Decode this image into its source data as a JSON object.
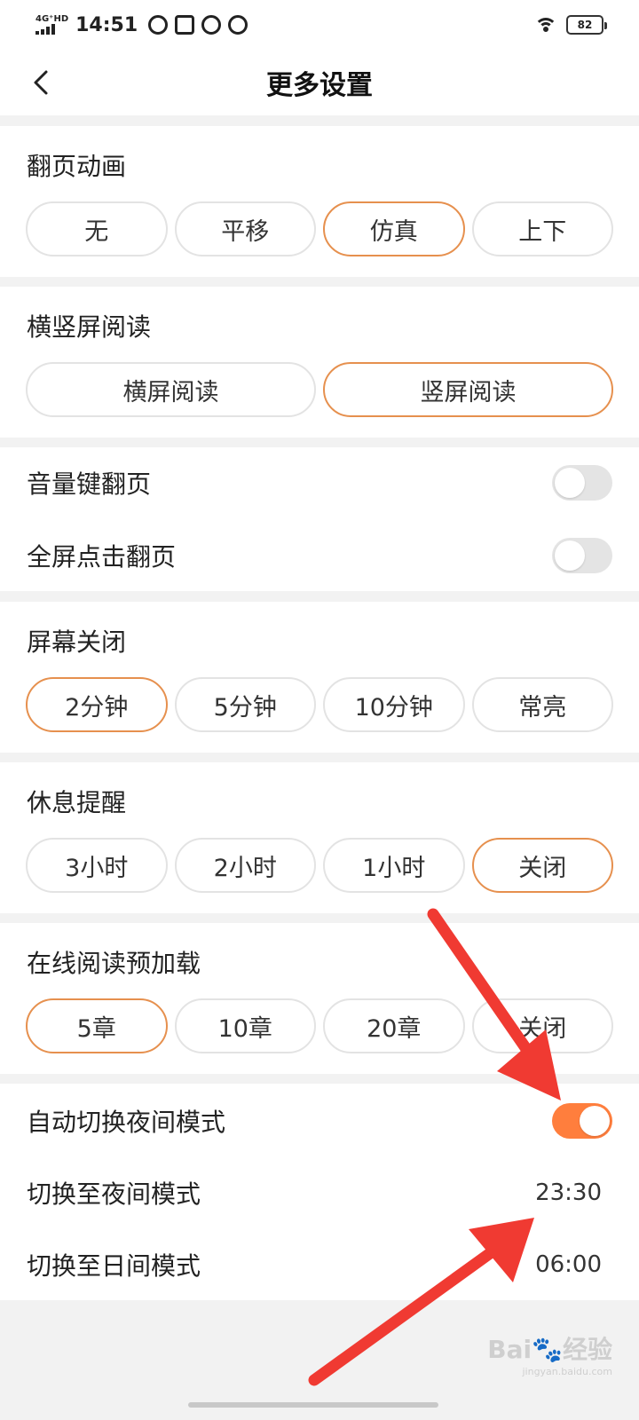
{
  "status": {
    "network": "4G⁺HD",
    "time": "14:51",
    "battery": "82",
    "app_icons": [
      "compass-icon",
      "play-store-icon",
      "weibo-icon",
      "weibo-icon"
    ]
  },
  "header": {
    "title": "更多设置"
  },
  "page_turn": {
    "label": "翻页动画",
    "options": [
      "无",
      "平移",
      "仿真",
      "上下"
    ],
    "selected": "仿真"
  },
  "orientation": {
    "label": "横竖屏阅读",
    "options": [
      "横屏阅读",
      "竖屏阅读"
    ],
    "selected": "竖屏阅读"
  },
  "volume_flip": {
    "label": "音量键翻页",
    "on": false
  },
  "fullscreen_tap": {
    "label": "全屏点击翻页",
    "on": false
  },
  "screen_off": {
    "label": "屏幕关闭",
    "options": [
      "2分钟",
      "5分钟",
      "10分钟",
      "常亮"
    ],
    "selected": "2分钟"
  },
  "rest_reminder": {
    "label": "休息提醒",
    "options": [
      "3小时",
      "2小时",
      "1小时",
      "关闭"
    ],
    "selected": "关闭"
  },
  "preload": {
    "label": "在线阅读预加载",
    "options": [
      "5章",
      "10章",
      "20章",
      "关闭"
    ],
    "selected": "5章"
  },
  "auto_night": {
    "label": "自动切换夜间模式",
    "on": true
  },
  "night_time": {
    "label": "切换至夜间模式",
    "value": "23:30"
  },
  "day_time": {
    "label": "切换至日间模式",
    "value": "06:00"
  },
  "watermark": {
    "brand": "Bai",
    "suffix": "经验",
    "url": "jingyan.baidu.com"
  },
  "colors": {
    "accent": "#ff7e3d",
    "selected_border": "#e6904e",
    "annotation_arrow": "#f03a32"
  }
}
